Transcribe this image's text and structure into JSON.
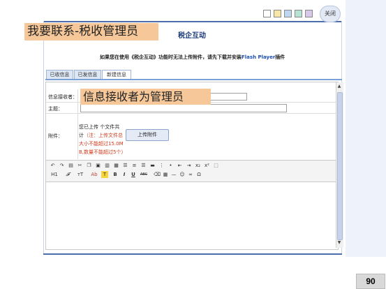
{
  "window": {
    "title": "税企互动",
    "close_label": "关闭"
  },
  "colors": {
    "accent": "#4a6ea9",
    "callout": "#f6c899",
    "tab_border": "#7aa0d6",
    "warning_text": "#d23a1a"
  },
  "theme_swatches": [
    "#ffffff",
    "#f6e7a6",
    "#bcd7ef",
    "#b6e3d4",
    "#d8c8ea"
  ],
  "callouts": {
    "top": "我要联系-税收管理员",
    "middle": "信息接收者为管理员"
  },
  "notice": {
    "before": "如果您在使用《税企互动》功能时无法上传附件，请先下载并安装",
    "flash": "Flash Player",
    "after": "插件"
  },
  "tabs": [
    {
      "label": "已收信息",
      "active": false
    },
    {
      "label": "已发信息",
      "active": false
    },
    {
      "label": "新建信息",
      "active": true
    }
  ],
  "form": {
    "receiver_label": "信息接收者：",
    "receiver_value": "",
    "subject_label": "主题：",
    "subject_value": "",
    "attachment_label": "附件：",
    "attachment_line1": "您已上传 个文件共",
    "attachment_line2_prefix": "计",
    "attachment_note": "（注：上传文件总大小不能超过15.0M B,数量不能超过5个）",
    "upload_button": "上传附件"
  },
  "toolbar": {
    "row1": [
      "undo-icon",
      "redo-icon",
      "print-icon",
      "cut-icon",
      "copy-icon",
      "paste-icon",
      "paste-text-icon",
      "paste-word-icon",
      "align-left-icon",
      "align-center-icon",
      "align-right-icon",
      "justify-icon",
      "numbered-list-icon",
      "bulleted-list-icon",
      "outdent-icon",
      "indent-icon",
      "subscript-icon",
      "superscript-icon",
      "select-all-icon"
    ],
    "row2_labels": {
      "heading": "H1",
      "font": "𝓕",
      "size": "тT",
      "text_color": "Ab",
      "highlight": "T",
      "bold": "B",
      "italic": "I",
      "underline": "U",
      "strike": "ABC"
    },
    "row2_icons": [
      "eraser-icon",
      "table-icon",
      "horizontal-rule-icon",
      "emoticon-icon",
      "link-icon",
      "special-char-icon"
    ]
  },
  "page_number": "90"
}
